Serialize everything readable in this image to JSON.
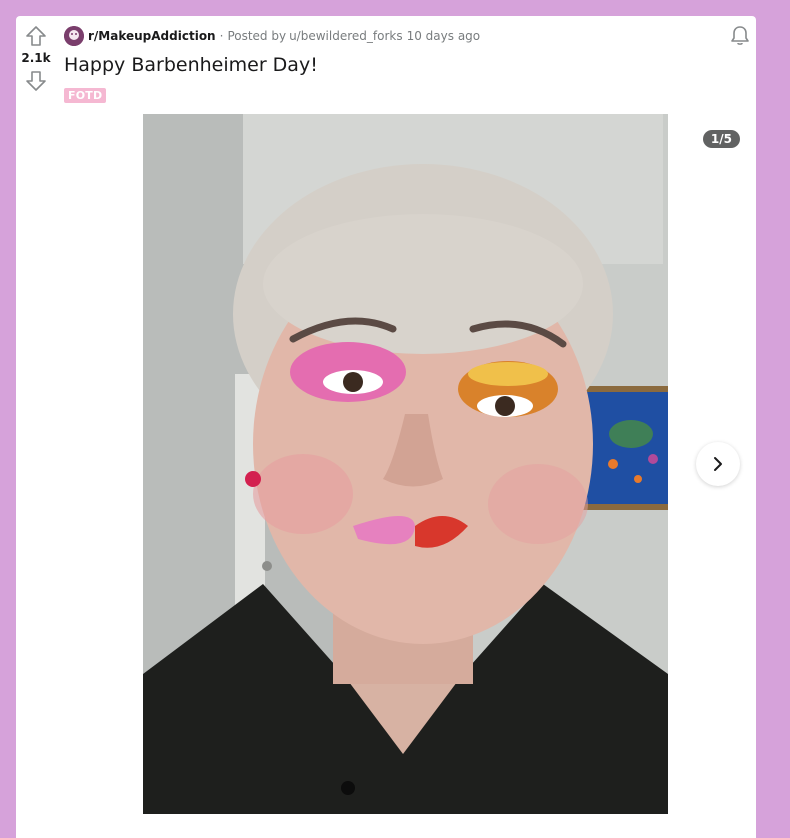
{
  "post": {
    "subreddit": "r/MakeupAddiction",
    "separator": "·",
    "posted_by_prefix": "Posted by",
    "author": "u/bewildered_forks",
    "age": "10 days ago",
    "score": "2.1k",
    "title": "Happy Barbenheimer Day!",
    "flair": "FOTD",
    "gallery": {
      "counter": "1/5",
      "image_description_icon": "photo"
    }
  },
  "colors": {
    "page_background": "#d6a2da",
    "flair_background": "#f5b8d2",
    "subreddit_icon": "#7a3e6c"
  },
  "icons": {
    "upvote": "up-arrow-outline",
    "downvote": "down-arrow-outline",
    "notify": "bell-outline",
    "next": "chevron-right"
  }
}
